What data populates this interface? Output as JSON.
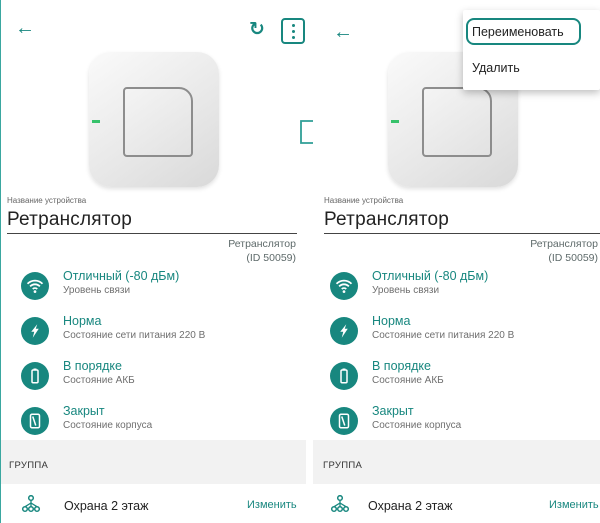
{
  "left_screen": {
    "back_icon": "arrow-left-icon",
    "refresh_icon": "refresh-icon",
    "more_icon": "more-vertical-icon",
    "device_name_caption": "Название устройства",
    "device_name": "Ретранслятор",
    "device_type_line1": "Ретранслятор",
    "device_type_line2": "(ID 50059)",
    "statuses": [
      {
        "title": "Отличный (-80 дБм)",
        "subtitle": "Уровень связи",
        "icon": "wifi-icon"
      },
      {
        "title": "Норма",
        "subtitle": "Состояние сети питания 220 В",
        "icon": "power-plug-icon"
      },
      {
        "title": "В порядке",
        "subtitle": "Состояние АКБ",
        "icon": "battery-icon"
      },
      {
        "title": "Закрыт",
        "subtitle": "Состояние корпуса",
        "icon": "case-icon"
      }
    ],
    "group_header": "ГРУППА",
    "group_name": "Охрана 2 этаж",
    "edit_label": "Изменить"
  },
  "right_screen": {
    "back_icon": "arrow-left-icon",
    "device_name_caption": "Название устройства",
    "device_name": "Ретранслятор",
    "device_type_line1": "Ретранслятор",
    "device_type_line2": "(ID 50059)",
    "statuses": [
      {
        "title": "Отличный (-80 дБм)",
        "subtitle": "Уровень связи",
        "icon": "wifi-icon"
      },
      {
        "title": "Норма",
        "subtitle": "Состояние сети питания 220 В",
        "icon": "power-plug-icon"
      },
      {
        "title": "В порядке",
        "subtitle": "Состояние АКБ",
        "icon": "battery-icon"
      },
      {
        "title": "Закрыт",
        "subtitle": "Состояние корпуса",
        "icon": "case-icon"
      }
    ],
    "group_header": "ГРУППА",
    "group_name": "Охрана 2 этаж",
    "edit_label": "Изменить",
    "menu": {
      "rename_label": "Переименовать",
      "delete_label": "Удалить"
    }
  },
  "colors": {
    "accent": "#18877f",
    "led": "#37c26b",
    "group_band": "#f2f2f2"
  }
}
